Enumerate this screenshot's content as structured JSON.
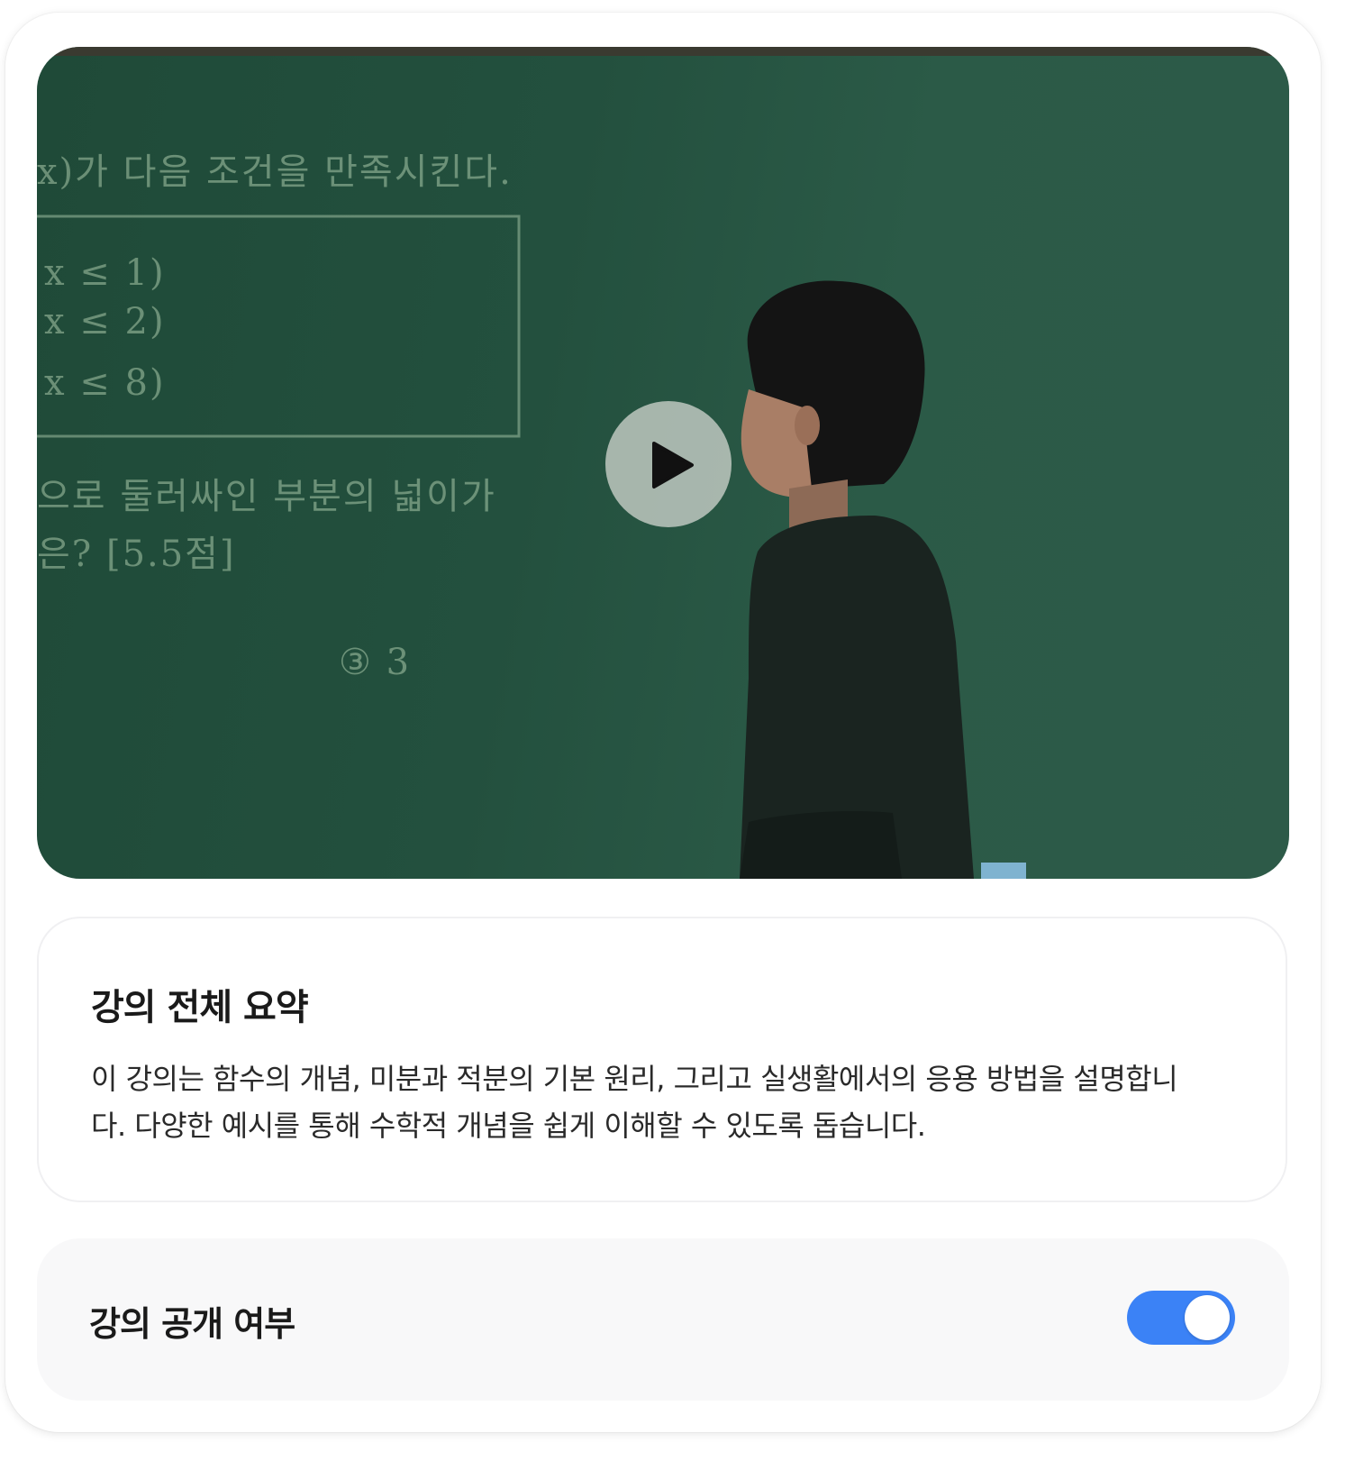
{
  "video": {
    "board_lines": [
      "x)가 다음 조건을 만족시킨다.",
      "x ≤ 1)",
      "x ≤ 2)",
      "x ≤ 8)",
      "으로 둘러싸인 부분의 넓이가",
      "은? [5.5점]",
      "③ 3"
    ],
    "play_icon": "play-icon"
  },
  "summary": {
    "title": "강의 전체 요약",
    "body": "이 강의는 함수의 개념, 미분과 적분의 기본 원리, 그리고 실생활에서의 응용 방법을 설명합니다. 다양한 예시를 통해 수학적 개념을 쉽게 이해할 수 있도록 돕습니다."
  },
  "visibility": {
    "label": "강의 공개 여부",
    "enabled": true,
    "accent_color": "#3b82f6"
  }
}
